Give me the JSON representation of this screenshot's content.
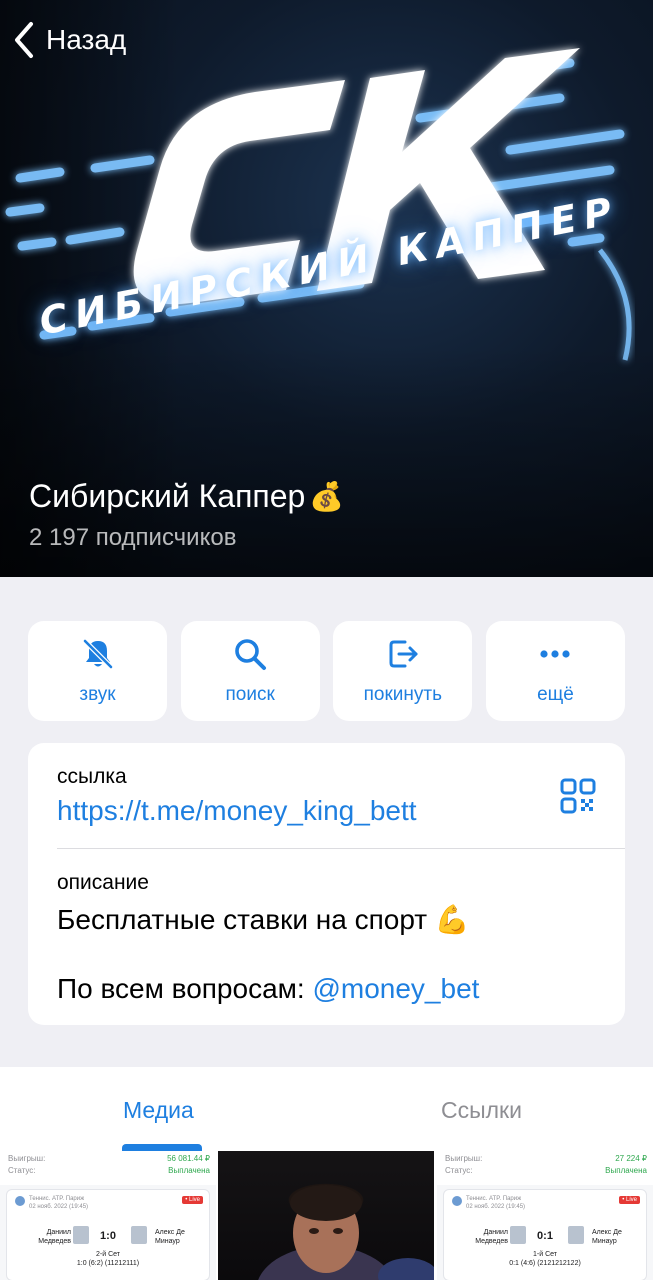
{
  "header": {
    "back_label": "Назад",
    "logo_word": "СИБИРСКИЙ КАППЕР",
    "channel_title": "Сибирский Каппер",
    "title_emoji": "💰",
    "subscribers": "2 197 подписчиков"
  },
  "actions": [
    {
      "label": "звук",
      "icon": "bell-slash-icon"
    },
    {
      "label": "поиск",
      "icon": "search-icon"
    },
    {
      "label": "покинуть",
      "icon": "leave-icon"
    },
    {
      "label": "ещё",
      "icon": "more-icon"
    }
  ],
  "info": {
    "link_label": "ссылка",
    "link_value": "https://t.me/money_king_bett",
    "description_label": "описание",
    "description_line1": "Бесплатные ставки на спорт",
    "description_emoji": "💪",
    "description_line2_prefix": "По всем вопросам:",
    "description_mention": "@money_bet"
  },
  "tabs": {
    "media": "Медиа",
    "links": "Ссылки",
    "active": "media"
  },
  "media": [
    {
      "type": "bet-slip",
      "win_label": "Выигрыш:",
      "win_value": "56 081.44 ₽",
      "status_label": "Статус:",
      "status_value": "Выплачена",
      "meta_line1": "Теннис. ATP. Париж",
      "meta_line2": "02 нояб. 2022 (19:45)",
      "live": "• Live",
      "player1": "Даниил Медведев",
      "player2": "Алекс Де Минаур",
      "score": "1:0",
      "set": "2-й Сет",
      "set_detail": "1:0 (6:2) (11212111)"
    },
    {
      "type": "photo"
    },
    {
      "type": "bet-slip",
      "win_label": "Выигрыш:",
      "win_value": "27 224 ₽",
      "status_label": "Статус:",
      "status_value": "Выплачена",
      "meta_line1": "Теннис. ATP. Париж",
      "meta_line2": "02 нояб. 2022 (19:45)",
      "live": "• Live",
      "player1": "Даниил Медведев",
      "player2": "Алекс Де Минаур",
      "score": "0:1",
      "set": "1-й Сет",
      "set_detail": "0:1 (4:6) (2121212122)"
    }
  ],
  "colors": {
    "accent": "#1e7fe0",
    "background": "#efeff4",
    "card": "#ffffff",
    "inactive_tab": "#8e8e93"
  }
}
